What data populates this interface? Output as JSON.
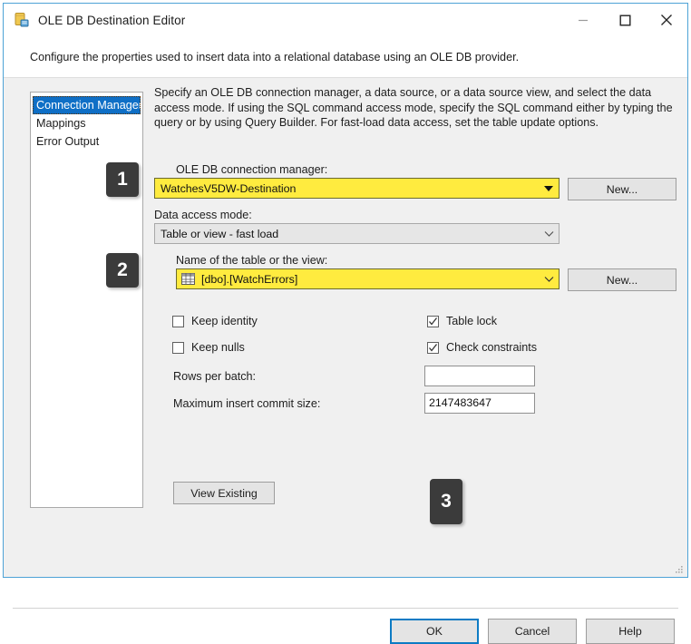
{
  "window": {
    "title": "OLE DB Destination Editor",
    "icon": "database-destination-icon",
    "controls": {
      "minimize": "minimize-icon",
      "maximize": "maximize-icon",
      "close": "close-icon"
    }
  },
  "header": {
    "description": "Configure the properties used to insert data into a relational database using an OLE DB provider."
  },
  "sidebar": {
    "items": [
      {
        "label": "Connection Manager",
        "selected": true
      },
      {
        "label": "Mappings",
        "selected": false
      },
      {
        "label": "Error Output",
        "selected": false
      }
    ]
  },
  "main": {
    "instructions": "Specify an OLE DB connection manager, a data source, or a data source view, and select the data access mode. If using the SQL command access mode, specify the SQL command either by typing the query or by using Query Builder. For fast-load data access, set the table update options.",
    "connection_manager": {
      "label": "OLE DB connection manager:",
      "value": "WatchesV5DW-Destination",
      "new_button": "New..."
    },
    "data_access_mode": {
      "label": "Data access mode:",
      "value": "Table or view - fast load"
    },
    "table_or_view": {
      "label": "Name of the table or the view:",
      "value": "[dbo].[WatchErrors]",
      "icon": "table-grid-icon",
      "new_button": "New..."
    },
    "options": [
      {
        "label": "Keep identity",
        "checked": false
      },
      {
        "label": "Keep nulls",
        "checked": false
      },
      {
        "label": "Table lock",
        "checked": true
      },
      {
        "label": "Check constraints",
        "checked": true
      }
    ],
    "rows_per_batch": {
      "label": "Rows per batch:",
      "value": "",
      "placeholder": ""
    },
    "maximum_insert_commit_size": {
      "label": "Maximum insert commit size:",
      "value": "2147483647",
      "placeholder": ""
    },
    "view_existing_button": "View Existing"
  },
  "badges": {
    "step1": "1",
    "step2": "2",
    "step3": "3"
  },
  "footer": {
    "ok": "OK",
    "cancel": "Cancel",
    "help": "Help"
  },
  "colors": {
    "highlight_yellow": "#ffeb3f",
    "selection_blue": "#0f6fc6",
    "focus_blue": "#0d7bc4",
    "badge_dark": "#3b3b3b",
    "window_border": "#4ea3d6"
  }
}
